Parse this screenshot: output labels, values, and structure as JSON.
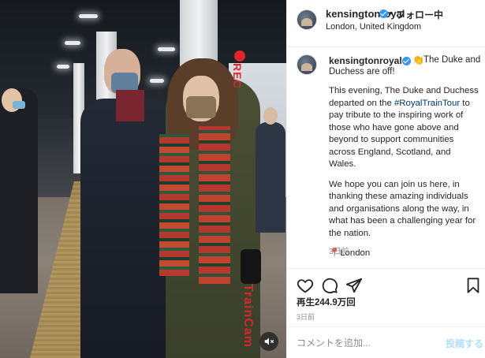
{
  "post": {
    "username": "kensingtonroyal",
    "follow_label": "フォロー中",
    "dot": "•",
    "location": "London, United Kingdom"
  },
  "caption": {
    "username": "kensingtonroyal",
    "emoji": "👏",
    "first_line_a": "The Duke and",
    "first_line_b": "Duchess are off!",
    "para1_before": "This evening, The Duke and Duchess departed on the ",
    "hashtag": "#RoyalTrainTour",
    "para1_after": " to pay tribute to the inspiring work of those who have gone above and beyond to support communities across England, Scotland, and Wales.",
    "para2": "We hope you can join us here, in thanking these amazing individuals and organisations along the way, in what has been a challenging year for the nation.",
    "pin_emoji": "📍",
    "place": "London",
    "time": "3日前"
  },
  "stats": {
    "likes": "再生244.9万回",
    "posted": "3日前"
  },
  "comment": {
    "placeholder": "コメントを追加...",
    "post_label": "投稿する"
  },
  "overlay": {
    "rec": "REC",
    "watermark": "TrainCam"
  },
  "colors": {
    "accent": "#3897f0",
    "link": "#00376b",
    "rec_red": "#e0262b",
    "post_disabled": "#b2dffc"
  },
  "icons": [
    "heart-icon",
    "comment-icon",
    "share-icon",
    "bookmark-icon",
    "mute-icon",
    "verified-icon",
    "pin-icon"
  ]
}
